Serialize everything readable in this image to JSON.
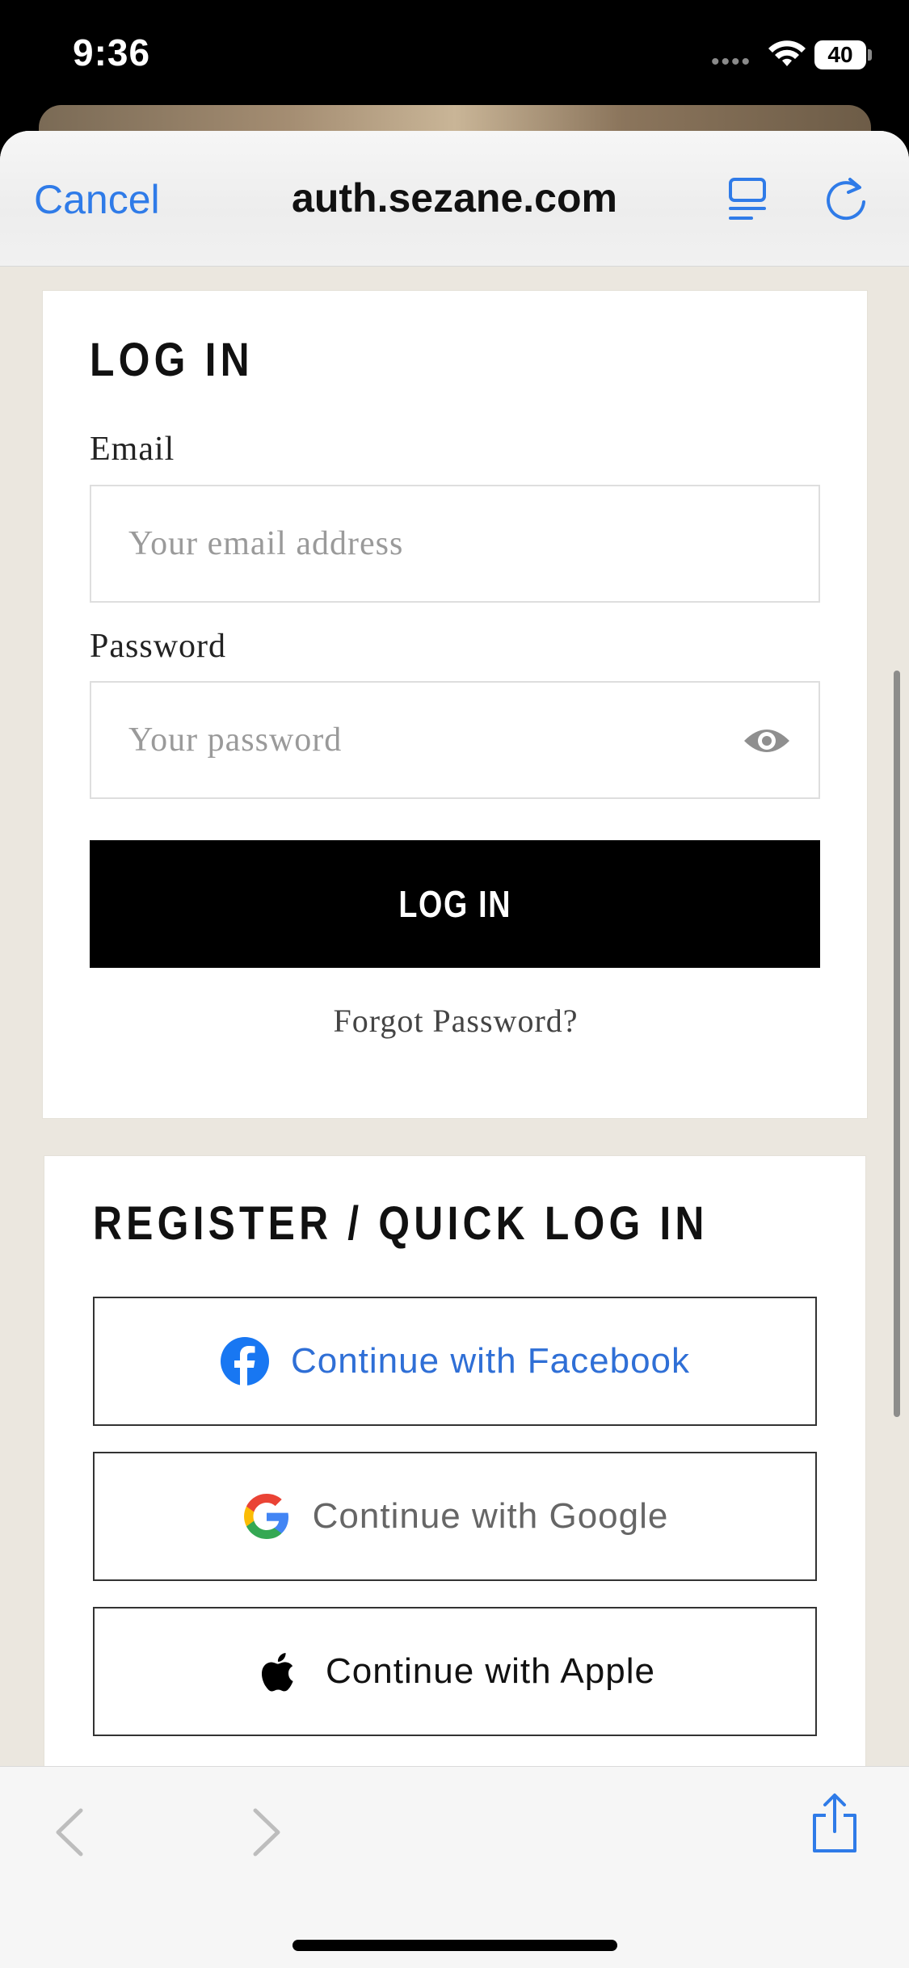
{
  "status_bar": {
    "time": "9:36",
    "signal_dots": "••••",
    "battery": "40"
  },
  "browser_sheet": {
    "cancel_label": "Cancel",
    "url_title": "auth.sezane.com",
    "accent_color": "#2f7be8"
  },
  "login_section": {
    "heading": "LOG IN",
    "email_label": "Email",
    "email_placeholder": "Your email address",
    "password_label": "Password",
    "password_placeholder": "Your password",
    "submit_label": "LOG IN",
    "forgot_label": "Forgot Password?"
  },
  "register_section": {
    "heading": "REGISTER / QUICK LOG IN",
    "buttons": [
      {
        "label": "Continue with Facebook",
        "icon": "facebook-icon",
        "color": "#2f6fd6"
      },
      {
        "label": "Continue with Google",
        "icon": "google-icon",
        "color": "#666666"
      },
      {
        "label": "Continue with Apple",
        "icon": "apple-icon",
        "color": "#111111"
      }
    ]
  },
  "toolbar": {
    "back": "chevron-left-icon",
    "forward": "chevron-right-icon",
    "share": "share-icon"
  }
}
